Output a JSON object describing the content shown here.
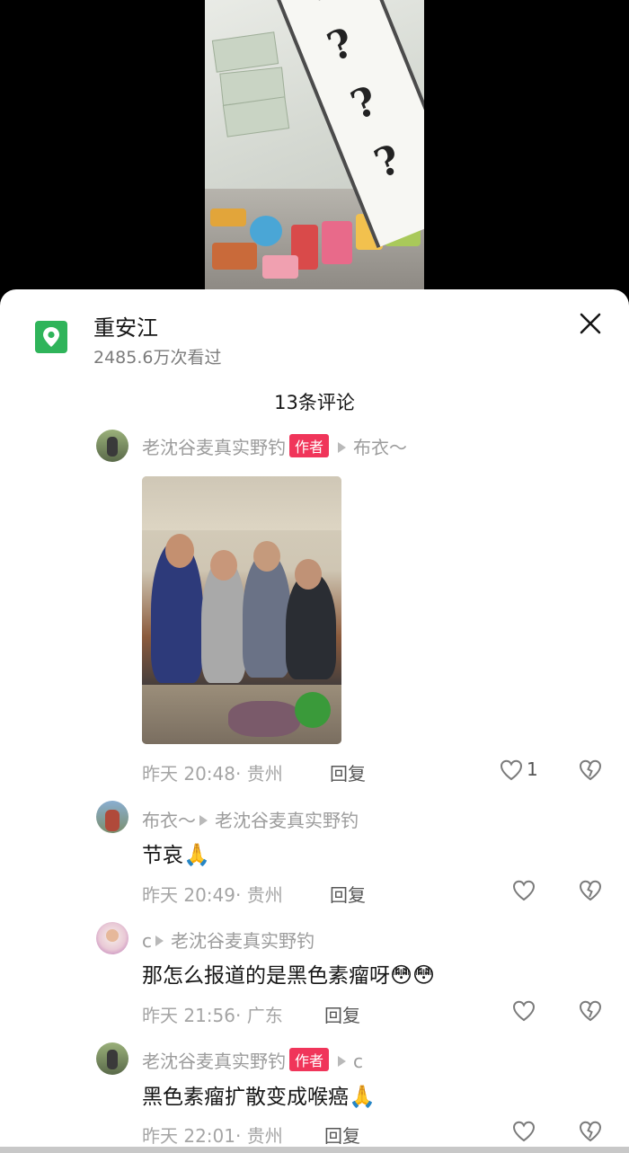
{
  "video": {
    "banner_chars": [
      "?",
      "?",
      "?",
      "?"
    ]
  },
  "location": {
    "name": "重安江",
    "views": "2485.6万次看过"
  },
  "comments_header": "13条评论",
  "comments": [
    {
      "user": "老沈谷麦真实野钓",
      "is_author": true,
      "author_badge": "作者",
      "reply_to": "布衣～",
      "text": "",
      "has_image": true,
      "time": "昨天 20:48· 贵州",
      "reply_label": "回复",
      "likes": "1"
    },
    {
      "user": "布衣～",
      "is_author": false,
      "reply_to": "老沈谷麦真实野钓",
      "text": "节哀",
      "emoji": "🙏",
      "time": "昨天 20:49· 贵州",
      "reply_label": "回复",
      "likes": ""
    },
    {
      "user": "c",
      "is_author": false,
      "reply_to": "老沈谷麦真实野钓",
      "text": "那怎么报道的是黑色素瘤呀",
      "emoji": "😳😳",
      "time": "昨天 21:56· 广东",
      "reply_label": "回复",
      "likes": ""
    },
    {
      "user": "老沈谷麦真实野钓",
      "is_author": true,
      "author_badge": "作者",
      "reply_to": "c",
      "text": "黑色素瘤扩散变成喉癌",
      "emoji": "🙏",
      "time": "昨天 22:01· 贵州",
      "reply_label": "回复",
      "likes": ""
    }
  ],
  "colors": {
    "accent_green": "#2fb45a",
    "author_badge": "#f0355a"
  }
}
